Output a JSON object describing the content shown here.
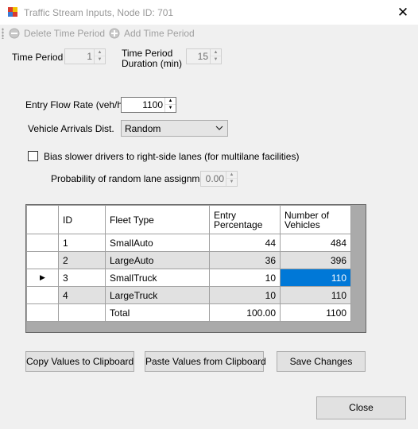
{
  "window": {
    "title": "Traffic Stream Inputs, Node ID: 701",
    "close_glyph": "✕"
  },
  "toolbar": {
    "delete_label": "Delete Time Period",
    "add_label": "Add Time Period"
  },
  "time_period": {
    "label": "Time Period",
    "value": "1"
  },
  "duration": {
    "label_line1": "Time Period",
    "label_line2": "Duration (min)",
    "value": "15"
  },
  "entry_flow": {
    "label": "Entry Flow Rate (veh/h)",
    "value": "1100"
  },
  "arrivals": {
    "label": "Vehicle Arrivals Dist.",
    "selected": "Random"
  },
  "bias": {
    "label": "Bias slower drivers to right-side lanes (for multilane facilities)",
    "checked": false
  },
  "probability": {
    "label": "Probability of random lane assignment",
    "value": "0.00"
  },
  "grid": {
    "columns": [
      "ID",
      "Fleet Type",
      "Entry Percentage",
      "Number of Vehicles"
    ],
    "column_lines": [
      [
        "ID"
      ],
      [
        "Fleet Type"
      ],
      [
        "Entry",
        "Percentage"
      ],
      [
        "Number of",
        "Vehicles"
      ]
    ],
    "rows": [
      {
        "id": "1",
        "fleet": "SmallAuto",
        "pct": "44",
        "num": "484"
      },
      {
        "id": "2",
        "fleet": "LargeAuto",
        "pct": "36",
        "num": "396"
      },
      {
        "id": "3",
        "fleet": "SmallTruck",
        "pct": "10",
        "num": "110"
      },
      {
        "id": "4",
        "fleet": "LargeTruck",
        "pct": "10",
        "num": "110"
      },
      {
        "id": "",
        "fleet": "Total",
        "pct": "100.00",
        "num": "1100"
      }
    ],
    "current_row_marker": "▶"
  },
  "buttons": {
    "copy": "Copy Values to Clipboard",
    "paste": "Paste Values from Clipboard",
    "save": "Save Changes",
    "close": "Close"
  },
  "icons": {
    "app": "app-icon",
    "delete": "delete-time-period-icon",
    "add": "add-time-period-icon",
    "chevron": "chevron-down-icon"
  },
  "colors": {
    "selection": "#0078d7",
    "alt_row": "#e1e1e1",
    "disabled_text": "#a0a0a0"
  }
}
